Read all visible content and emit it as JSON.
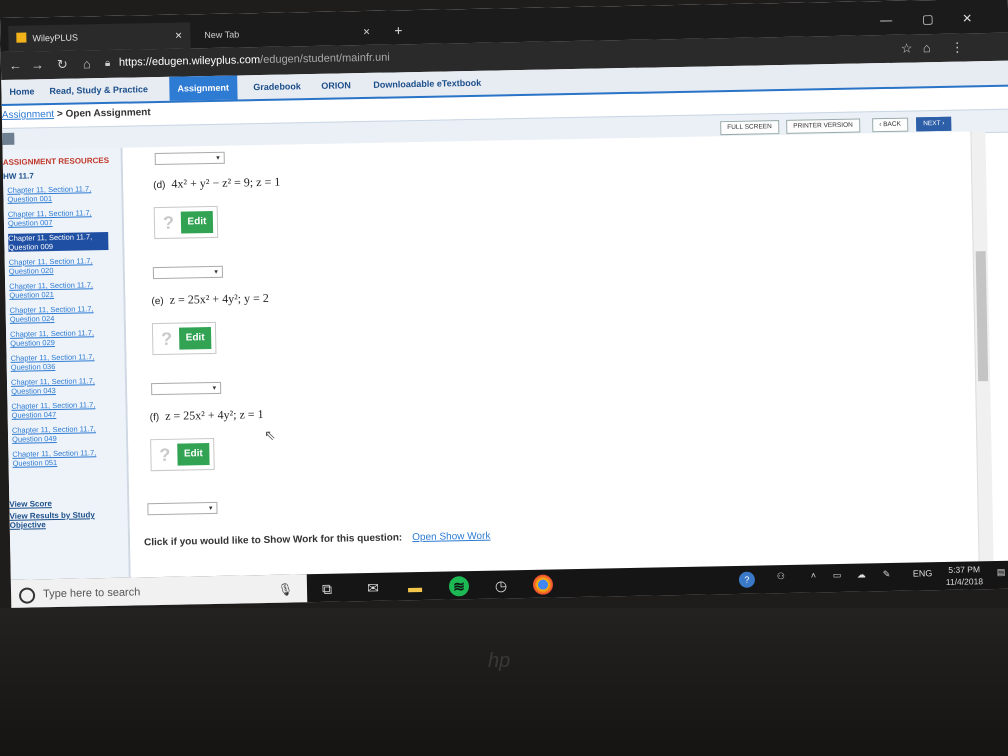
{
  "browser": {
    "tabs": [
      {
        "label": "WileyPLUS"
      },
      {
        "label": "New Tab"
      }
    ],
    "url_host": "https://edugen.wileyplus.com",
    "url_path": "/edugen/student/mainfr.uni"
  },
  "nav": {
    "items": [
      "Home",
      "Read, Study & Practice",
      "Assignment",
      "Gradebook",
      "ORION",
      "Downloadable eTextbook"
    ]
  },
  "breadcrumb": {
    "link": "Assignment",
    "sep": " > ",
    "current": "Open Assignment"
  },
  "toolbar": {
    "full_screen": "FULL SCREEN",
    "printer": "PRINTER VERSION",
    "back": "‹ BACK",
    "next": "NEXT ›"
  },
  "sidebar": {
    "heading": "ASSIGNMENT RESOURCES",
    "hw": "HW 11.7",
    "questions": [
      "Chapter 11, Section 11.7, Question 001",
      "Chapter 11, Section 11.7, Question 007",
      "Chapter 11, Section 11.7, Question 009",
      "Chapter 11, Section 11.7, Question 020",
      "Chapter 11, Section 11.7, Question 021",
      "Chapter 11, Section 11.7, Question 024",
      "Chapter 11, Section 11.7, Question 029",
      "Chapter 11, Section 11.7, Question 036",
      "Chapter 11, Section 11.7, Question 043",
      "Chapter 11, Section 11.7, Question 047",
      "Chapter 11, Section 11.7, Question 049",
      "Chapter 11, Section 11.7, Question 051"
    ],
    "view_score": "View Score",
    "view_results": "View Results by Study Objective"
  },
  "main": {
    "parts": [
      {
        "label": "(d)",
        "equation": "4x² + y² − z² = 9; z = 1"
      },
      {
        "label": "(e)",
        "equation": "z = 25x² + 4y²; y = 2"
      },
      {
        "label": "(f)",
        "equation": "z = 25x² + 4y²; z = 1"
      }
    ],
    "edit_label": "Edit",
    "question_mark": "?",
    "show_work_text": "Click if you would like to Show Work for this question:",
    "show_work_link": "Open Show Work"
  },
  "taskbar": {
    "search_placeholder": "Type here to search",
    "lang": "ENG",
    "time": "5:37 PM",
    "date": "11/4/2018"
  }
}
